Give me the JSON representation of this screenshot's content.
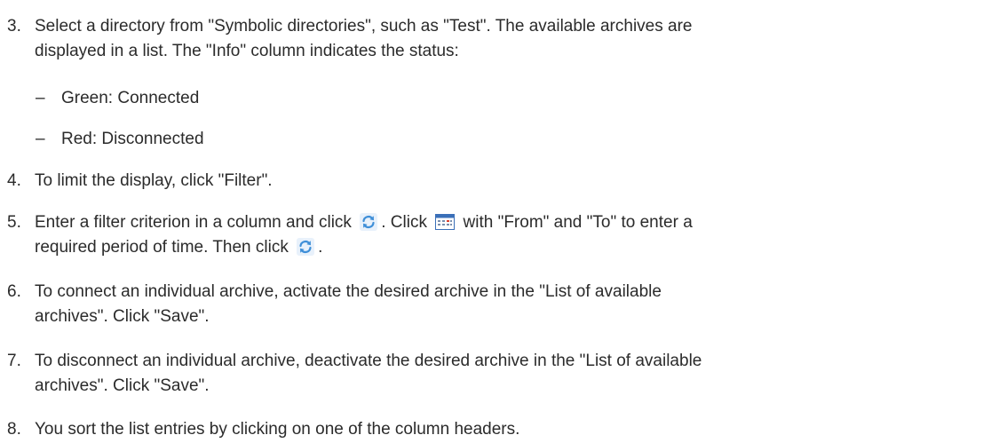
{
  "steps": [
    {
      "number": "3.",
      "lines": [
        "Select a directory from \"Symbolic directories\", such as \"Test\". The available archives are",
        "displayed in a list. The \"Info\" column indicates the status:"
      ]
    },
    {
      "number": "4.",
      "lines": [
        "To limit the display, click \"Filter\"."
      ]
    },
    {
      "number": "5.",
      "line1_part1": "Enter a filter criterion in a column and click",
      "line1_part2": ". Click",
      "line1_part3": "with \"From\" and \"To\" to enter a",
      "line2_part1": "required period of time. Then click",
      "line2_part2": "."
    },
    {
      "number": "6.",
      "lines": [
        "To connect an individual archive, activate the desired archive in the \"List of available",
        "archives\". Click \"Save\"."
      ]
    },
    {
      "number": "7.",
      "lines": [
        "To disconnect an individual archive, deactivate the desired archive in the \"List of available",
        "archives\". Click \"Save\"."
      ]
    },
    {
      "number": "8.",
      "lines": [
        "You sort the list entries by clicking on one of the column headers."
      ]
    }
  ],
  "substeps": [
    {
      "dash": "–",
      "text": "Green: Connected"
    },
    {
      "dash": "–",
      "text": "Red: Disconnected"
    }
  ],
  "icons": {
    "refresh": "refresh-icon",
    "calendar": "calendar-icon"
  },
  "colors": {
    "text": "#2b2b2b",
    "refresh_blue": "#3f8fd8",
    "calendar_blue": "#3a6fb8",
    "calendar_red": "#d8402f"
  }
}
